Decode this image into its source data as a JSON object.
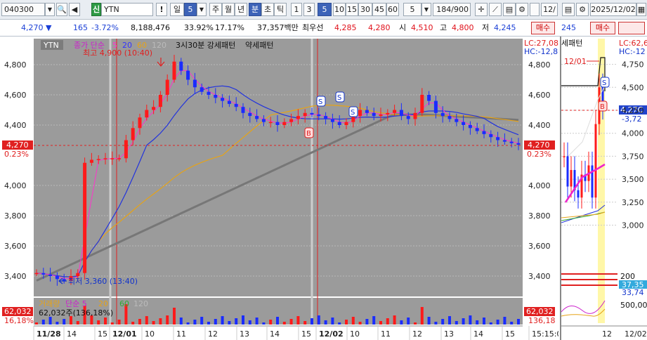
{
  "toolbar": {
    "code": "040300",
    "name_badge": "신",
    "name": "YTN",
    "buttons": [
      "!",
      "일",
      "5",
      "주",
      "월",
      "년",
      "분",
      "초",
      "틱",
      "1",
      "3",
      "5",
      "10",
      "15",
      "30",
      "45",
      "60",
      "5"
    ],
    "active": [
      "5",
      "분",
      "5"
    ],
    "count": "184",
    "count_total": "/900",
    "right_code": "12/",
    "date": "2025/12/02"
  },
  "quote": {
    "price": "4,270",
    "change": "165",
    "change_pct": "-3.72%",
    "volume": "8,188,476",
    "turnover_pct": "33.92%",
    "vol_ratio": "17.17%",
    "amount": "37,357백만",
    "best_label": "최우선",
    "best_ask": "4,285",
    "best_bid": "4,280",
    "open_label": "시",
    "open": "4,510",
    "high_label": "고",
    "high": "4,800",
    "low_label": "저",
    "low": "4,245",
    "buy_label": "매수",
    "side_price": "245",
    "side_buy_label": "매수"
  },
  "chart": {
    "ticker_tag": "YTN",
    "legend": [
      {
        "text": "종가 단순",
        "color": "#cc22cc"
      },
      {
        "text": "5",
        "color": "#ff33cc"
      },
      {
        "text": "20",
        "color": "#3333ff"
      },
      {
        "text": "60",
        "color": "#e6a317"
      },
      {
        "text": "120",
        "color": "#bbbbbb"
      }
    ],
    "pattern_a": "3시30분 강세패턴",
    "pattern_b": "약세패턴",
    "lc": "LC:27,08",
    "hc": "HC:-12,8",
    "high_note": "최고 4,900 (10:40)",
    "low_note": "최저 3,360 (13:40)",
    "current_price": "4,270",
    "current_pct": "0.23%",
    "y_ticks": [
      "4,800",
      "4,600",
      "4,400",
      "4,000",
      "3,800",
      "3,600",
      "3,400"
    ],
    "x_labels": [
      "11/28",
      "14",
      "15",
      "12/01",
      "10",
      "11",
      "12",
      "13",
      "14",
      "15",
      "12/02",
      "10",
      "11",
      "12",
      "13",
      "14",
      "15",
      "15:15:0"
    ],
    "marks": [
      "S",
      "S",
      "S",
      "B"
    ],
    "volume_legend": [
      {
        "text": "거래량",
        "color": "#e6a317"
      },
      {
        "text": "단순 5",
        "color": "#cc22cc"
      },
      {
        "text": "20",
        "color": "#e6a317"
      },
      {
        "text": "60",
        "color": "#33aa33"
      },
      {
        "text": "120",
        "color": "#bbbbbb"
      }
    ],
    "volume_value": "62,032주(136,18%)",
    "volume_badge": "62,032",
    "volume_pct": "16,18%",
    "volume_right": "62,032",
    "volume_right_pct": "136,18"
  },
  "side": {
    "title": "세패턴",
    "lc": "LC:62,6",
    "hc": "HC:-12",
    "date_note": "12/01",
    "marks": [
      "S",
      "B"
    ],
    "price_tag": "4,27C",
    "price_pct": "-3,72",
    "y_ticks": [
      "4,750",
      "4,500",
      "4,250",
      "4,000",
      "3,750",
      "3,500",
      "3,250",
      "3,000"
    ],
    "vol_ticks": [
      "200",
      "37,35",
      "33,74",
      "500,00"
    ],
    "x_labels": [
      "12",
      "12/02"
    ]
  },
  "chart_data": {
    "type": "candlestick",
    "title": "YTN",
    "ylim": [
      3300,
      4900
    ],
    "moving_averages": [
      "5",
      "20",
      "60",
      "120"
    ],
    "high": {
      "value": 4900,
      "time": "10:40"
    },
    "low": {
      "value": 3360,
      "time": "13:40"
    },
    "last": 4270,
    "sessions": [
      "11/28",
      "12/01",
      "12/02"
    ],
    "close_path": [
      3420,
      3410,
      3400,
      3380,
      3370,
      3400,
      3420,
      4150,
      4170,
      4175,
      4180,
      4180,
      4180,
      4300,
      4380,
      4450,
      4500,
      4520,
      4600,
      4700,
      4820,
      4760,
      4700,
      4650,
      4620,
      4600,
      4580,
      4560,
      4540,
      4520,
      4480,
      4460,
      4440,
      4420,
      4420,
      4400,
      4420,
      4440,
      4460,
      4480,
      4470,
      4460,
      4440,
      4420,
      4400,
      4420,
      4460,
      4500,
      4480,
      4460,
      4470,
      4480,
      4500,
      4460,
      4440,
      4480,
      4600,
      4560,
      4480,
      4460,
      4440,
      4420,
      4400,
      4380,
      4360,
      4340,
      4320,
      4300,
      4290,
      4280,
      4270
    ]
  }
}
